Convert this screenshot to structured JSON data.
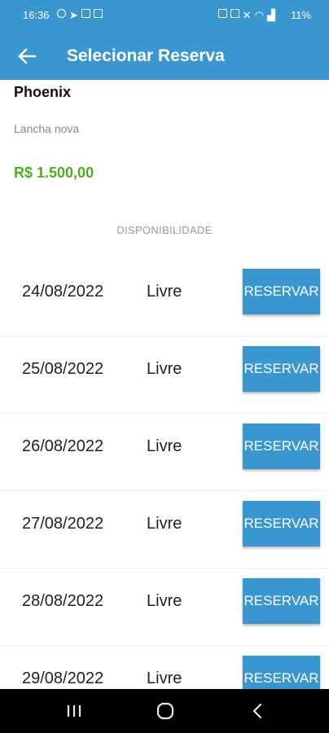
{
  "status_bar": {
    "time": "16:36",
    "battery": "11%",
    "left_icons": [
      "instagram-icon",
      "telegram-icon",
      "gallery-icon",
      "notification-icon"
    ],
    "right_icons": [
      "alarm-icon",
      "vibrate-icon",
      "mute-icon",
      "wifi-icon",
      "signal-icon"
    ]
  },
  "app_bar": {
    "title": "Selecionar Reserva",
    "back_icon": "arrow-left-icon",
    "color": "#3a96cf"
  },
  "boat": {
    "name": "Phoenix",
    "description": "Lancha nova",
    "price": "R$ 1.500,00",
    "price_color": "#4caf1f"
  },
  "availability": {
    "label": "DISPONIBILIDADE",
    "rows": [
      {
        "date": "24/08/2022",
        "status": "Livre",
        "button": "RESERVAR"
      },
      {
        "date": "25/08/2022",
        "status": "Livre",
        "button": "RESERVAR"
      },
      {
        "date": "26/08/2022",
        "status": "Livre",
        "button": "RESERVAR"
      },
      {
        "date": "27/08/2022",
        "status": "Livre",
        "button": "RESERVAR"
      },
      {
        "date": "28/08/2022",
        "status": "Livre",
        "button": "RESERVAR"
      },
      {
        "date": "29/08/2022",
        "status": "Livre",
        "button": "RESERVAR"
      }
    ]
  },
  "nav_bar": {
    "items": [
      "recent-apps-icon",
      "home-icon",
      "back-icon"
    ]
  }
}
